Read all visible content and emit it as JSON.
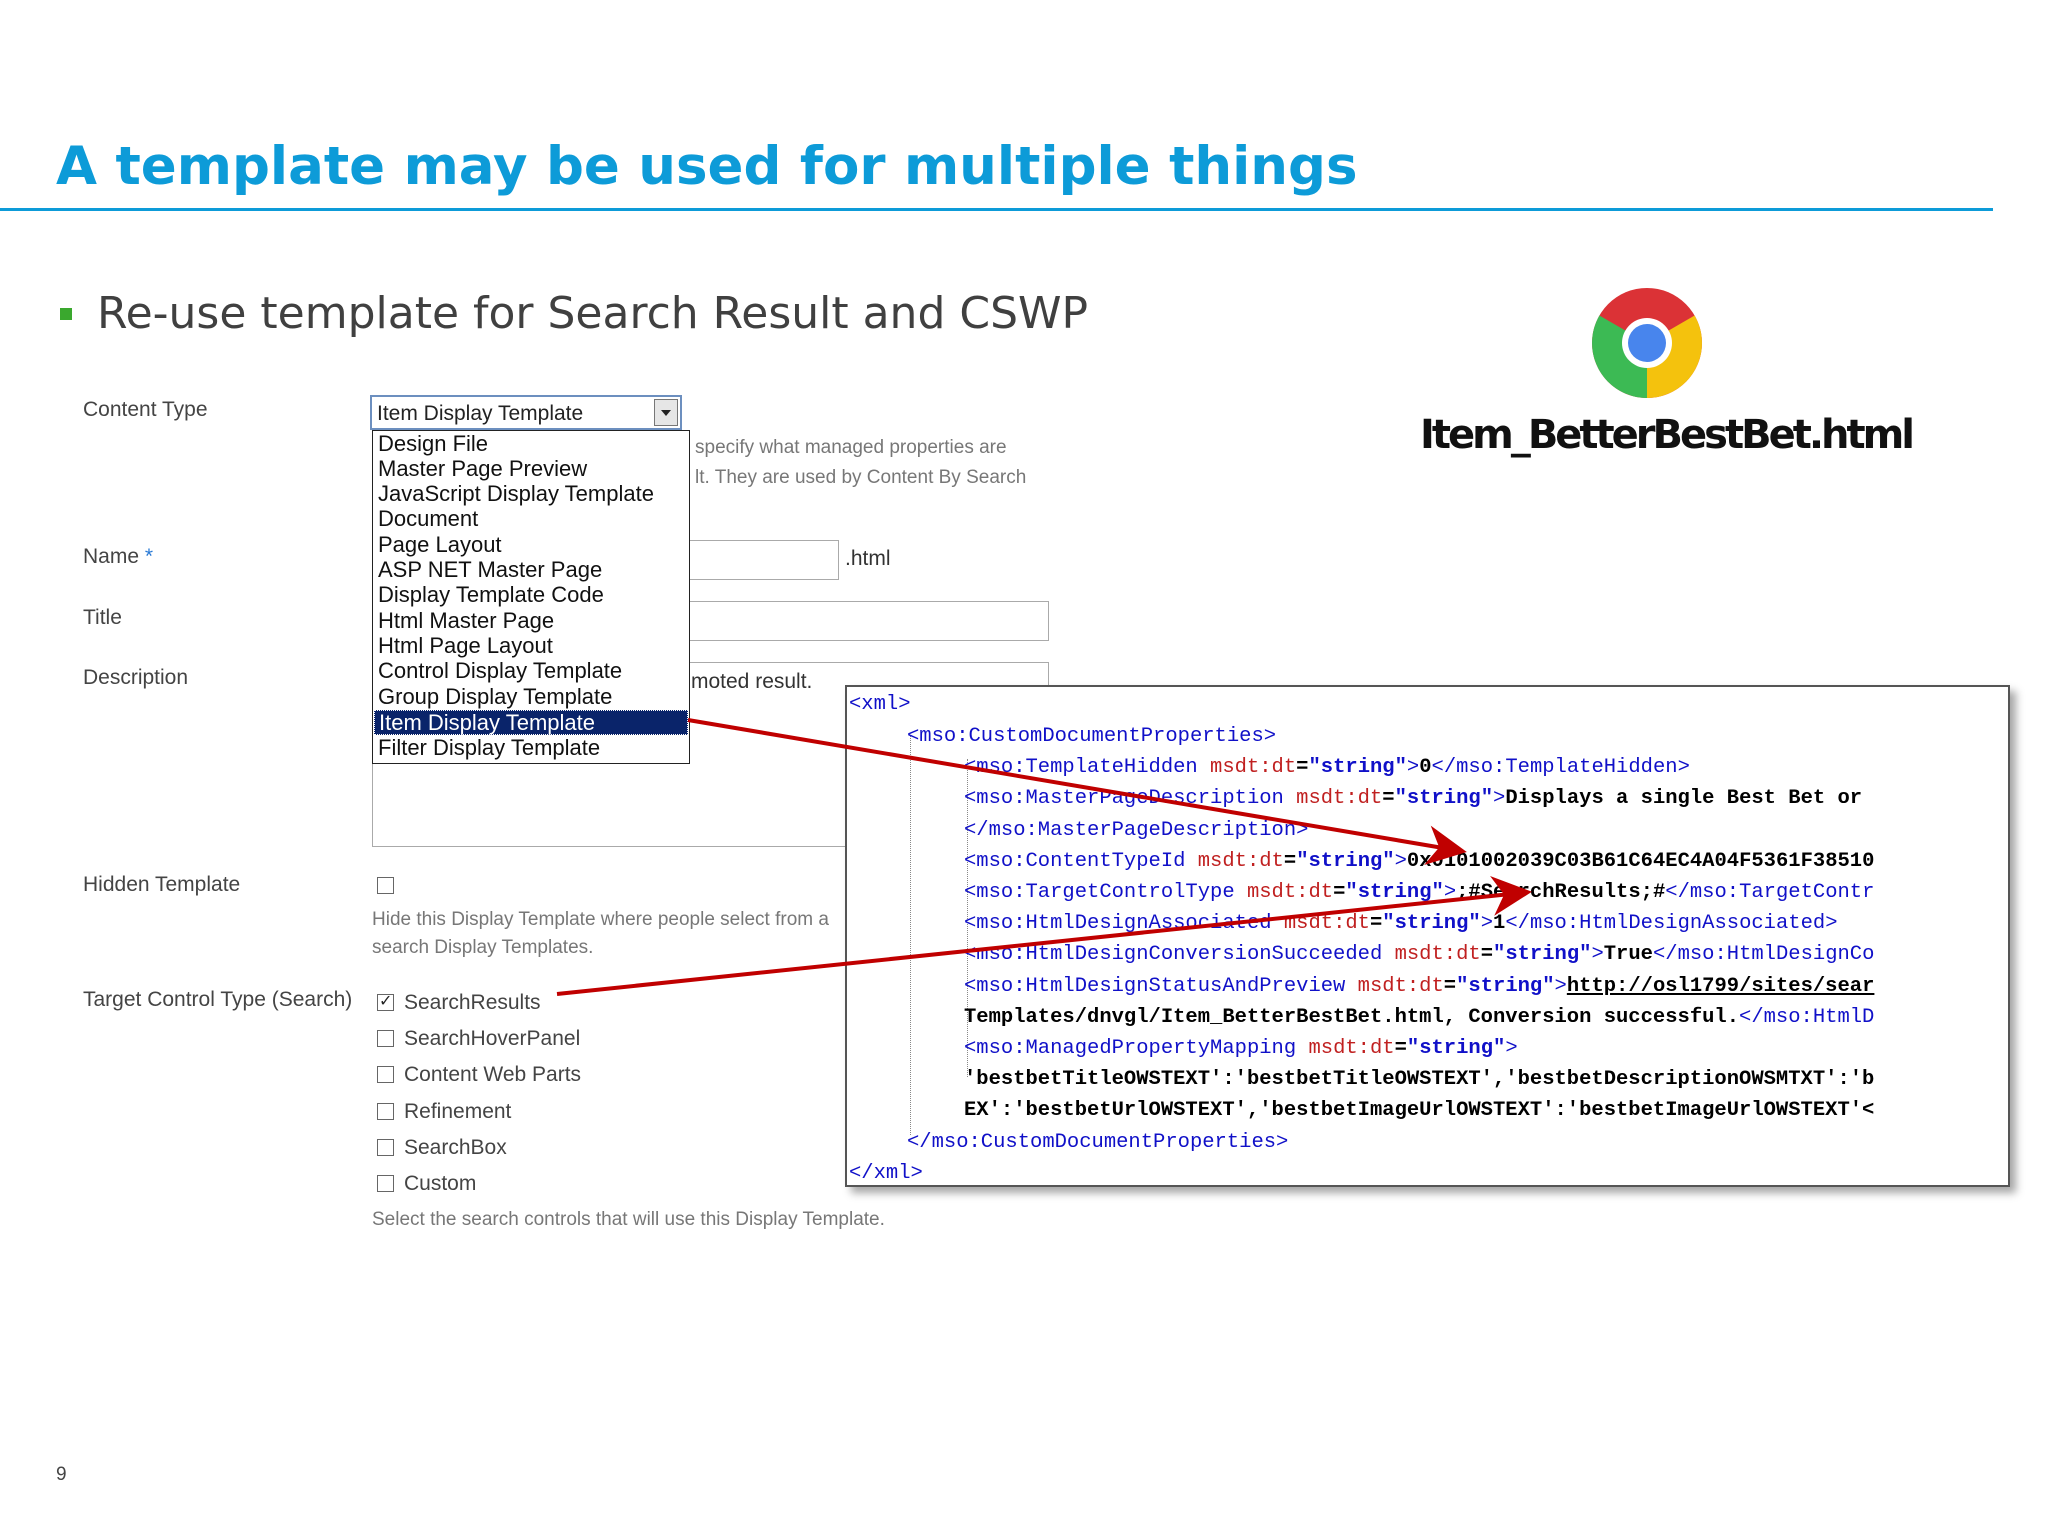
{
  "slide": {
    "title": "A template may be used for multiple things",
    "bullet": "Re-use template for Search Result and CSWP",
    "page_number": "9"
  },
  "form": {
    "content_type_label": "Content Type",
    "content_type_value": "Item Display Template",
    "content_type_options": [
      "Design File",
      "Master Page Preview",
      "JavaScript Display Template",
      "Document",
      "Page Layout",
      "ASP NET Master Page",
      "Display Template Code",
      "Html Master Page",
      "Html Page Layout",
      "Control Display Template",
      "Group Display Template",
      "Item Display Template",
      "Filter Display Template"
    ],
    "content_type_hint_1": "specify what managed properties are",
    "content_type_hint_2": "lt.  They are used by Content By Search",
    "name_label": "Name",
    "name_required": "*",
    "name_suffix": ".html",
    "title_label": "Title",
    "description_label": "Description",
    "description_value": "moted result.",
    "hidden_template_label": "Hidden Template",
    "hidden_template_checked": false,
    "hidden_hint_1": "Hide this Display Template where people select from a",
    "hidden_hint_2": "search Display Templates.",
    "target_label": "Target Control Type (Search)",
    "target_options": [
      {
        "label": "SearchResults",
        "checked": true
      },
      {
        "label": "SearchHoverPanel",
        "checked": false
      },
      {
        "label": "Content Web Parts",
        "checked": false
      },
      {
        "label": "Refinement",
        "checked": false
      },
      {
        "label": "SearchBox",
        "checked": false
      },
      {
        "label": "Custom",
        "checked": false
      }
    ],
    "target_hint": "Select the search controls that will use this Display Template."
  },
  "logo": {
    "icon": "chrome-icon",
    "filename": "Item_BetterBestBet.html"
  },
  "code": {
    "l1": "<xml>",
    "l2": "<mso:CustomDocumentProperties>",
    "l3_open": "<mso:TemplateHidden ",
    "l3_attr": "msdt:dt",
    "l3_str": "\"string\"",
    "l3_val": "0",
    "l3_close": "</mso:TemplateHidden>",
    "l4_open": "<mso:MasterPageDescription ",
    "l4_attr": "msdt:dt",
    "l4_str": "\"string\"",
    "l4_val": "Displays a single Best Bet or",
    "l5": "</mso:MasterPageDescription>",
    "l6_open": "<mso:ContentTypeId ",
    "l6_attr": "msdt:dt",
    "l6_str": "\"string\"",
    "l6_val": "0x0101002039C03B61C64EC4A04F5361F38510",
    "l7_open": "<mso:TargetControlType ",
    "l7_attr": "msdt:dt",
    "l7_str": "\"string\"",
    "l7_val": ";#SearchResults;#",
    "l7_close": "</mso:TargetContr",
    "l8_open": "<mso:HtmlDesignAssociated ",
    "l8_attr": "msdt:dt",
    "l8_str": "\"string\"",
    "l8_val": "1",
    "l8_close": "</mso:HtmlDesignAssociated>",
    "l9_open": "<mso:HtmlDesignConversionSucceeded ",
    "l9_attr": "msdt:dt",
    "l9_str": "\"string\"",
    "l9_val": "True",
    "l9_close": "</mso:HtmlDesignCo",
    "l10_open": "<mso:HtmlDesignStatusAndPreview ",
    "l10_attr": "msdt:dt",
    "l10_str": "\"string\"",
    "l10_val": "http://osl1799/sites/sear",
    "l11_val": "Templates/dnvgl/Item_BetterBestBet.html, Conversion successful.",
    "l11_close": "</mso:HtmlD",
    "l12_open": "<mso:ManagedPropertyMapping ",
    "l12_attr": "msdt:dt",
    "l12_str": "\"string\"",
    "l13_val": "'bestbetTitleOWSTEXT':'bestbetTitleOWSTEXT','bestbetDescriptionOWSMTXT':'b",
    "l14_val": "EX':'bestbetUrlOWSTEXT','bestbetImageUrlOWSTEXT':'bestbetImageUrlOWSTEXT'<",
    "l15": "</mso:CustomDocumentProperties>",
    "l16": "</xml>"
  },
  "colors": {
    "title": "#0d9bd8",
    "bullet": "#3aa82e",
    "arrow": "#c00000",
    "selection": "#0a246a"
  }
}
